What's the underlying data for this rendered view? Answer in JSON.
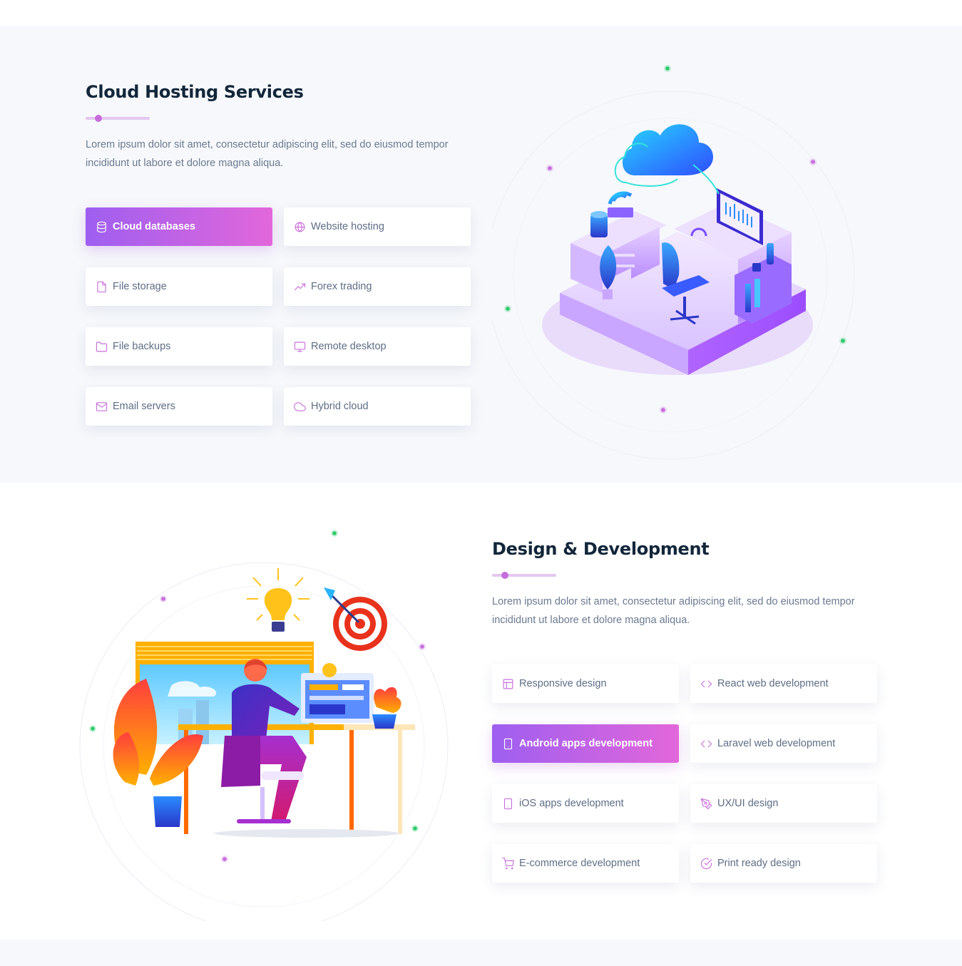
{
  "sections": [
    {
      "title": "Cloud Hosting Services",
      "description": "Lorem ipsum dolor sit amet, consectetur adipiscing elit, sed do eiusmod tempor incididunt ut labore et dolore magna aliqua.",
      "active_item": "Cloud databases",
      "items": [
        {
          "label": "Cloud databases",
          "icon": "database-icon"
        },
        {
          "label": "Website hosting",
          "icon": "globe-icon"
        },
        {
          "label": "File storage",
          "icon": "file-icon"
        },
        {
          "label": "Forex trading",
          "icon": "trending-up-icon"
        },
        {
          "label": "File backups",
          "icon": "folder-icon"
        },
        {
          "label": "Remote desktop",
          "icon": "monitor-icon"
        },
        {
          "label": "Email servers",
          "icon": "mail-icon"
        },
        {
          "label": "Hybrid cloud",
          "icon": "cloud-icon"
        }
      ]
    },
    {
      "title": "Design & Development",
      "description": "Lorem ipsum dolor sit amet, consectetur adipiscing elit, sed do eiusmod tempor incididunt ut labore et dolore magna aliqua.",
      "active_item": "Android apps development",
      "items": [
        {
          "label": "Responsive design",
          "icon": "layout-icon"
        },
        {
          "label": "React web development",
          "icon": "code-icon"
        },
        {
          "label": "Android apps development",
          "icon": "smartphone-icon"
        },
        {
          "label": "Laravel web development",
          "icon": "code-icon"
        },
        {
          "label": "iOS apps development",
          "icon": "smartphone-icon"
        },
        {
          "label": "UX/UI design",
          "icon": "pen-tool-icon"
        },
        {
          "label": "E-commerce development",
          "icon": "shopping-cart-icon"
        },
        {
          "label": "Print ready design",
          "icon": "check-circle-icon"
        }
      ]
    }
  ],
  "colors": {
    "accent_gradient_start": "#9e5ff0",
    "accent_gradient_end": "#e267da",
    "icon": "#c96fdc",
    "title": "#12263a",
    "text": "#6b7a90",
    "section_bg": "#f6f8fb"
  }
}
